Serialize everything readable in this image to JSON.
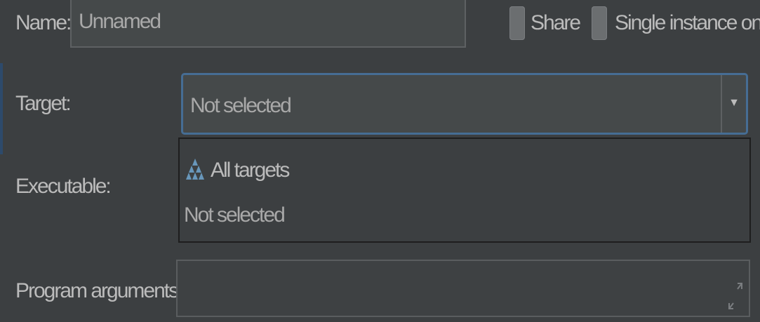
{
  "name": {
    "label": "Name:",
    "value": "Unnamed"
  },
  "share": {
    "label": "Share"
  },
  "single_instance": {
    "label": "Single instance only"
  },
  "target": {
    "label": "Target:",
    "value": "Not selected"
  },
  "target_dropdown": {
    "options": [
      {
        "label": "All targets",
        "icon": "targets-icon"
      },
      {
        "label": "Not selected"
      }
    ]
  },
  "executable": {
    "label": "Executable:"
  },
  "program_arguments": {
    "label": "Program arguments:",
    "value": ""
  },
  "colors": {
    "background": "#3c3f41",
    "focus": "#466d94",
    "text": "#bbbbbb"
  }
}
